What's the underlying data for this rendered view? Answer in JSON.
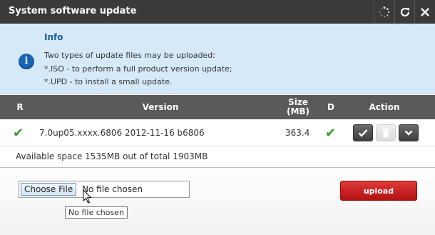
{
  "window": {
    "title": "System software update",
    "icons": [
      "spinner-icon",
      "refresh-icon",
      "close-icon"
    ]
  },
  "info": {
    "title": "Info",
    "lines": [
      "Two types of update files may be uploaded:",
      "*.ISO - to perform a full product version update;",
      "*.UPD - to install a small update."
    ]
  },
  "table": {
    "headers": {
      "r": "R",
      "version": "Version",
      "size": "Size (MB)",
      "d": "D",
      "action": "Action"
    },
    "rows": [
      {
        "version": "7.0up05.xxxx.6806 2012-11-16 b6806",
        "size": "363.4"
      }
    ]
  },
  "space_text": "Available space 1535MB out of total 1903MB",
  "upload": {
    "choose_label": "Choose File",
    "no_file": "No file chosen",
    "tooltip": "No file chosen",
    "button": "upload"
  },
  "colors": {
    "titlebar": "#3a3a3a",
    "info_bg": "#d6e9f9",
    "header_bg": "#5a5a5a",
    "upload": "#c41a1a",
    "check": "#3a9a2a"
  }
}
